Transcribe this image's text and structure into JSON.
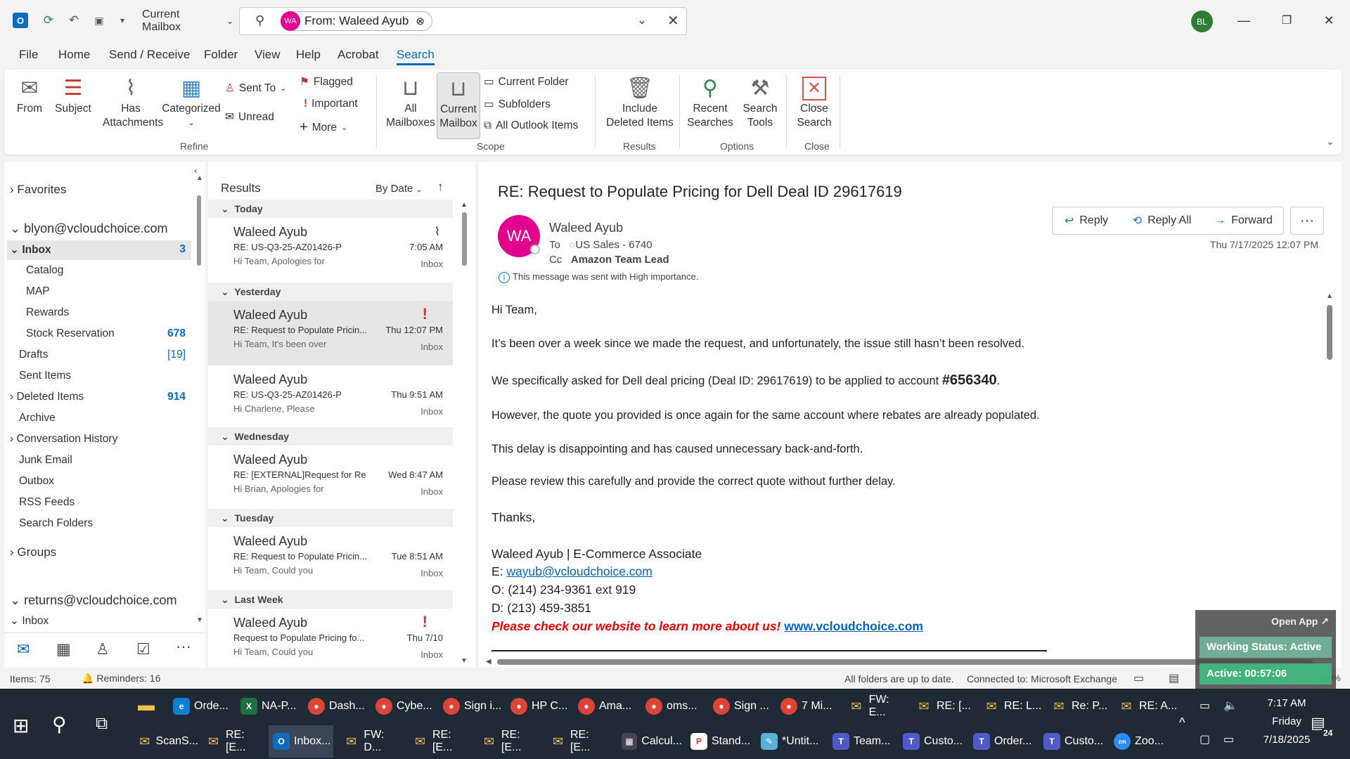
{
  "titlebar": {
    "mailbox_scope": "Current Mailbox",
    "search_chip_initials": "WA",
    "search_chip_label": "From: Waleed Ayub",
    "user_initials": "BL"
  },
  "menu": [
    "File",
    "Home",
    "Send / Receive",
    "Folder",
    "View",
    "Help",
    "Acrobat",
    "Search"
  ],
  "ribbon": {
    "refine": {
      "from": "From",
      "subject": "Subject",
      "has_attachments": "Has Attachments",
      "categorized": "Categorized",
      "sent_to": "Sent To",
      "unread": "Unread",
      "flagged": "Flagged",
      "important": "Important",
      "more": "More",
      "label": "Refine"
    },
    "scope": {
      "all_mailboxes": "All Mailboxes",
      "current_mailbox": "Current Mailbox",
      "current_folder": "Current Folder",
      "subfolders": "Subfolders",
      "all_outlook_items": "All Outlook Items",
      "label": "Scope"
    },
    "results": {
      "include_deleted": "Include Deleted Items",
      "label": "Results"
    },
    "options": {
      "recent_searches": "Recent Searches",
      "search_tools": "Search Tools",
      "label": "Options"
    },
    "close": {
      "close_search": "Close Search",
      "label": "Close"
    }
  },
  "folders": {
    "favorites": "Favorites",
    "account1": "blyon@vcloudchoice.com",
    "inbox": "Inbox",
    "inbox_count": "3",
    "catalog": "Catalog",
    "map": "MAP",
    "rewards": "Rewards",
    "stock_reservation": "Stock Reservation",
    "stock_count": "678",
    "drafts": "Drafts",
    "drafts_count": "[19]",
    "sent": "Sent Items",
    "deleted": "Deleted Items",
    "deleted_count": "914",
    "archive": "Archive",
    "conv_history": "Conversation History",
    "junk": "Junk Email",
    "outbox": "Outbox",
    "rss": "RSS Feeds",
    "search_folders": "Search Folders",
    "groups": "Groups",
    "account2": "returns@vcloudchoice.com",
    "inbox2": "Inbox"
  },
  "results": {
    "title": "Results",
    "sort": "By Date",
    "sections": {
      "today": "Today",
      "yesterday": "Yesterday",
      "wednesday": "Wednesday",
      "tuesday": "Tuesday",
      "last_week": "Last Week"
    },
    "messages": [
      {
        "from": "Waleed Ayub",
        "subject": "RE: US-Q3-25-AZ01426-P",
        "preview": "Hi Team,  Apologies for",
        "date": "7:05 AM",
        "folder": "Inbox"
      },
      {
        "from": "Waleed Ayub",
        "subject": "RE: Request to Populate Pricin...",
        "preview": "Hi Team,  It's been over",
        "date": "Thu 12:07 PM",
        "folder": "Inbox"
      },
      {
        "from": "Waleed Ayub",
        "subject": "RE: US-Q3-25-AZ01426-P",
        "preview": "Hi Charlene,  Please",
        "date": "Thu 9:51 AM",
        "folder": "Inbox"
      },
      {
        "from": "Waleed Ayub",
        "subject": "RE: [EXTERNAL]Request for Re...",
        "preview": "Hi Brian,  Apologies for",
        "date": "Wed 8:47 AM",
        "folder": "Inbox"
      },
      {
        "from": "Waleed Ayub",
        "subject": "RE: Request to Populate Pricin...",
        "preview": "Hi Team,  Could you",
        "date": "Tue 8:51 AM",
        "folder": "Inbox"
      },
      {
        "from": "Waleed Ayub",
        "subject": "Request to Populate Pricing fo...",
        "preview": "Hi Team,  Could you",
        "date": "Thu 7/10",
        "folder": "Inbox"
      }
    ]
  },
  "email": {
    "subject": "RE: Request to Populate Pricing for Dell Deal ID 29617619",
    "sender_initials": "WA",
    "sender": "Waleed Ayub",
    "to_label": "To",
    "to": "US Sales - 6740",
    "cc_label": "Cc",
    "cc": "Amazon Team Lead",
    "date": "Thu 7/17/2025 12:07 PM",
    "importance": "This message was sent with High importance.",
    "reply": "Reply",
    "reply_all": "Reply All",
    "forward": "Forward",
    "greeting": "Hi Team,",
    "p1": "It’s been over a week since we made the request, and unfortunately, the issue still hasn’t been resolved.",
    "p2a": "We specifically asked for Dell deal pricing (Deal ID: 29617619) to be applied to account ",
    "p2b": "#656340",
    "p2c": ".",
    "p3": "However, the quote you provided is once again for the same account where rebates are already populated.",
    "p4": "This delay is disappointing and has caused unnecessary back-and-forth.",
    "p5": "Please review this carefully and provide the correct quote without further delay.",
    "thanks": "Thanks,",
    "sig_name": "Waleed Ayub | E-Commerce Associate",
    "sig_e_label": "E: ",
    "sig_email": "wayub@vcloudchoice.com",
    "sig_o": "O: (214) 234-9361 ext 919",
    "sig_d": "D: (213) 459-3851",
    "sig_promo": "Please check our website to learn more about us!",
    "sig_site": "www.vcloudchoice.com"
  },
  "status": {
    "items": "Items: 75",
    "reminders": "Reminders: 16",
    "uptodate": "All folders are up to date.",
    "connected": "Connected to: Microsoft Exchange",
    "zoom": "100%"
  },
  "overlay": {
    "open_app": "Open App",
    "working_status": "Working Status: Active",
    "active_timer": "Active: 00:57:06"
  },
  "taskbar": {
    "row1": [
      "Orde...",
      "NA-P...",
      "Dash...",
      "Cybe...",
      "Sign i...",
      "HP C...",
      "Ama...",
      "oms...",
      "Sign ...",
      "7 Mi...",
      "FW: E...",
      "RE: [...",
      "RE: L...",
      "Re: P...",
      "RE: A..."
    ],
    "row2": [
      "ScanS...",
      "RE: [E...",
      "Inbox...",
      "FW: D...",
      "RE: [E...",
      "RE: [E...",
      "RE: [E...",
      "Calcul...",
      "Stand...",
      "*Untit...",
      "Team...",
      "Custo...",
      "Order...",
      "Custo...",
      "Zoo..."
    ],
    "time": "7:17 AM",
    "day": "Friday",
    "date": "7/18/2025",
    "notif": "24"
  }
}
